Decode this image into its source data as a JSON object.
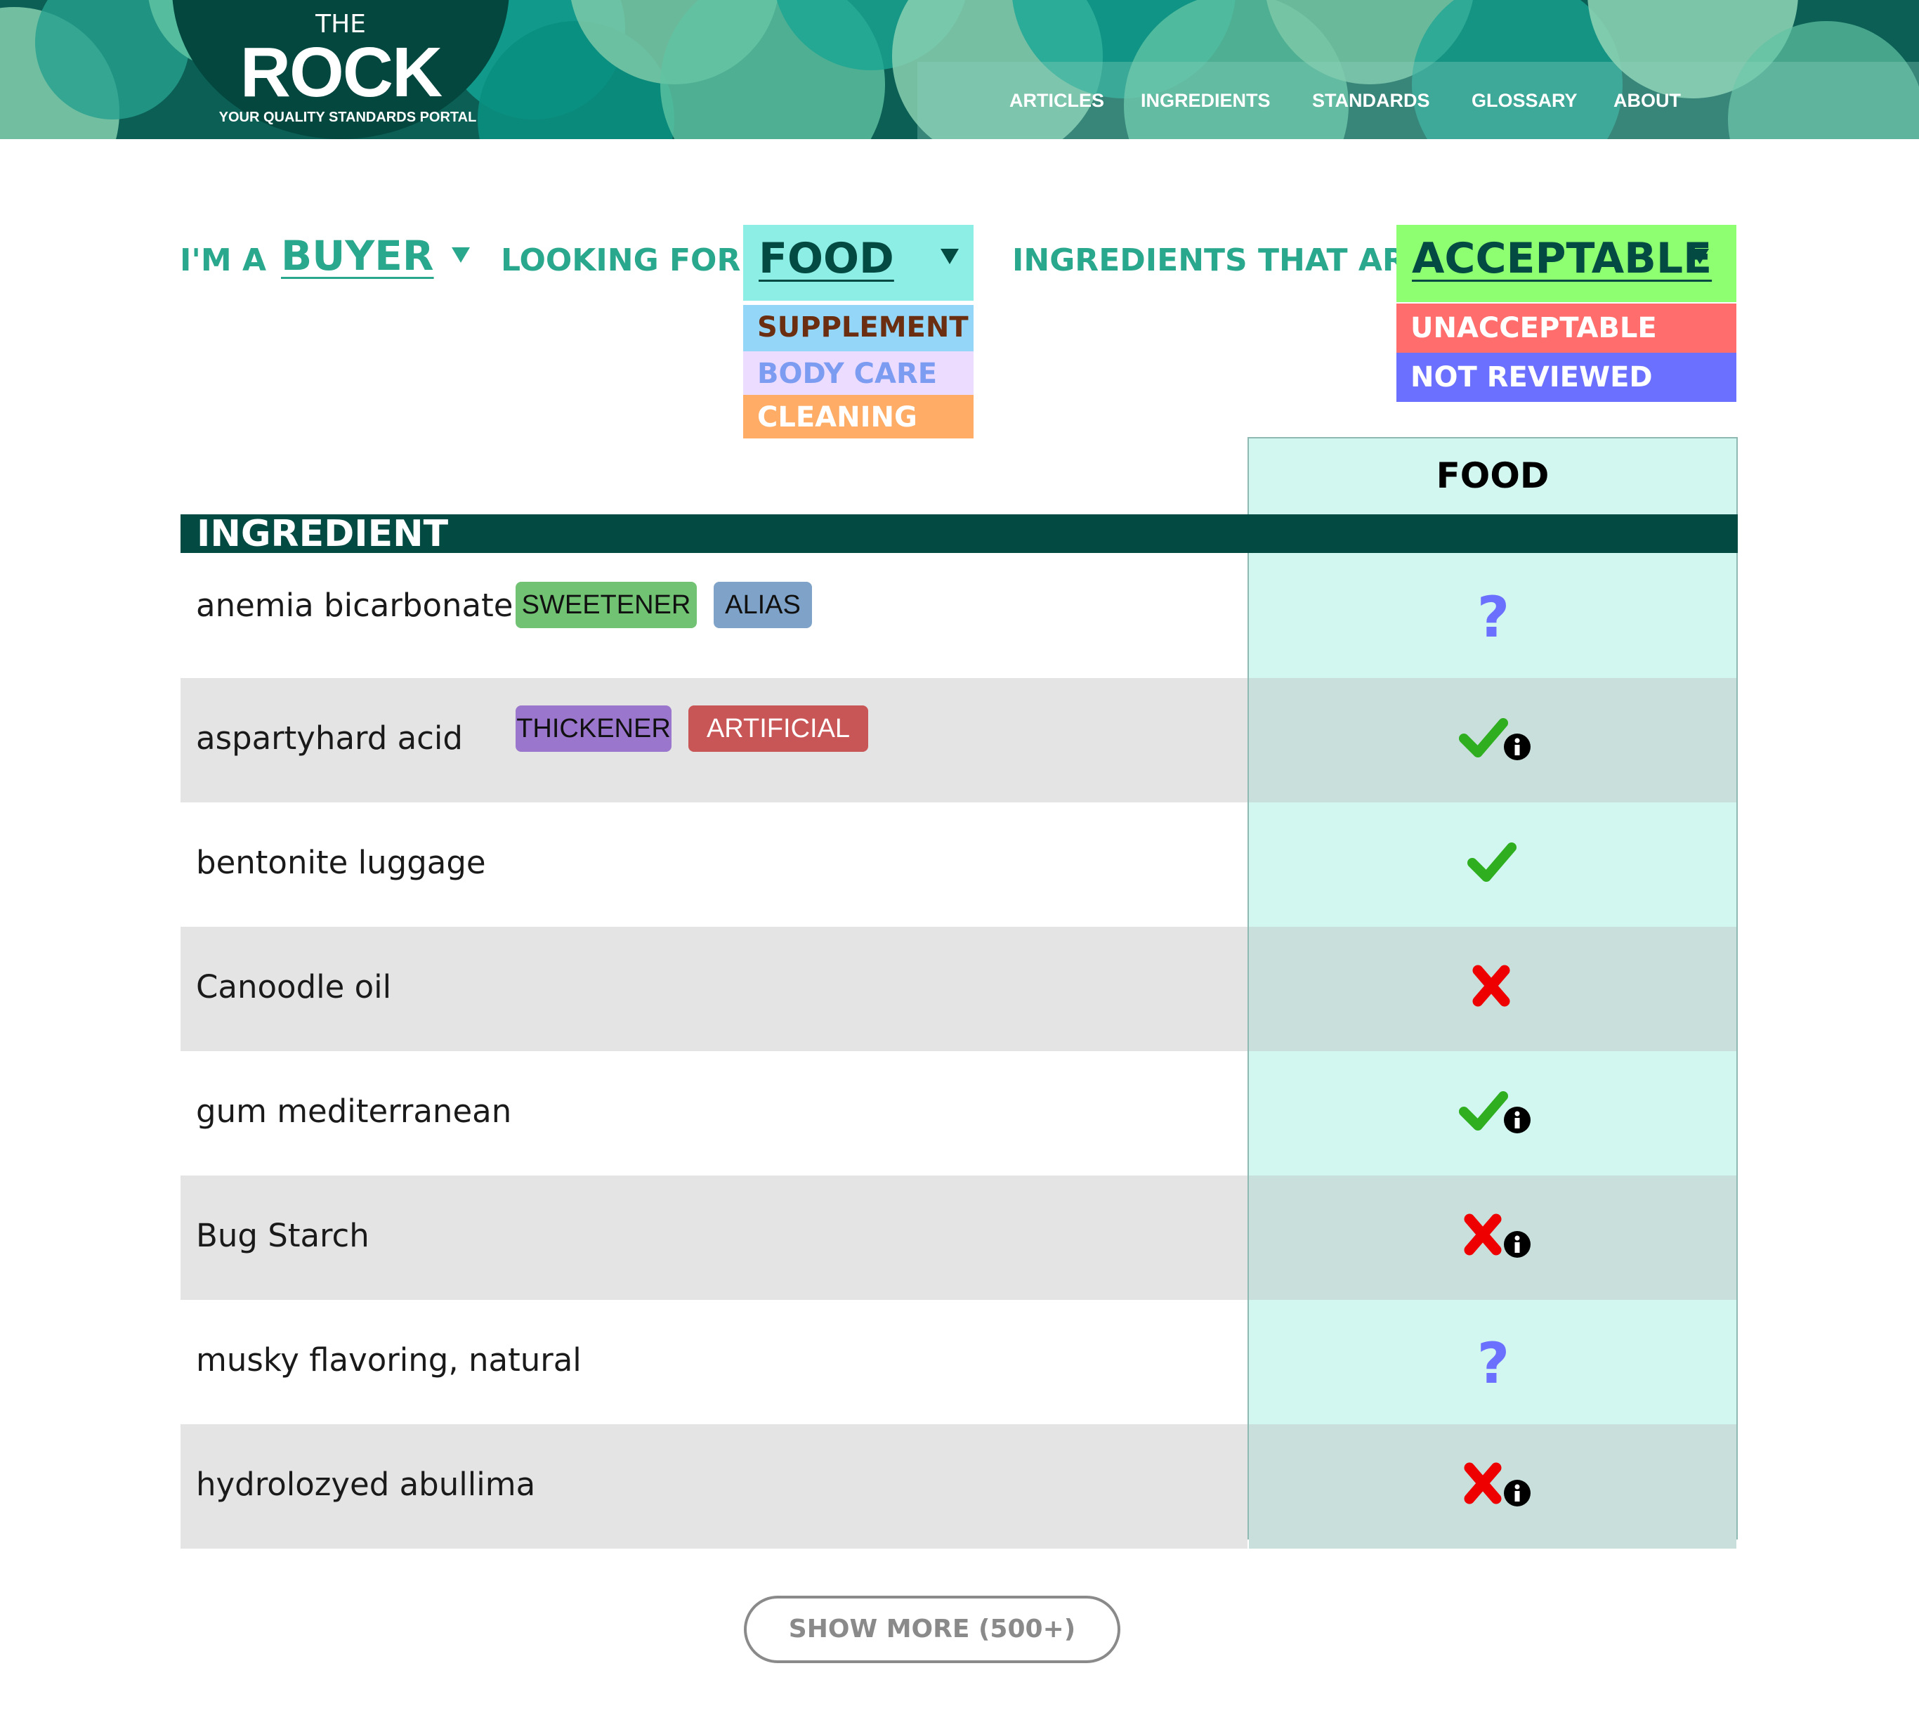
{
  "brand": {
    "the": "THE",
    "rock": "ROCK",
    "tagline": "YOUR QUALITY STANDARDS PORTAL"
  },
  "nav": {
    "articles": "ARTICLES",
    "ingredients": "INGREDIENTS",
    "standards": "STANDARDS",
    "glossary": "GLOSSARY",
    "about": "ABOUT"
  },
  "filters": {
    "im_a_label": "I'M A",
    "role_value": "BUYER",
    "looking_for_label": "LOOKING FOR",
    "category_value": "FOOD",
    "category_options": [
      "SUPPLEMENT",
      "BODY CARE",
      "CLEANING"
    ],
    "status_label": "INGREDIENTS THAT ARE",
    "status_value": "ACCEPTABLE",
    "status_options": [
      "UNACCEPTABLE",
      "NOT REVIEWED"
    ]
  },
  "table": {
    "ingredient_header": "INGREDIENT",
    "column_header": "FOOD",
    "rows": [
      {
        "name": "anemia bicarbonate",
        "tags": [
          "SWEETENER",
          "ALIAS"
        ],
        "status": "not-reviewed",
        "info": false
      },
      {
        "name": "aspartyhard acid",
        "tags": [
          "THICKENER",
          "ARTIFICIAL"
        ],
        "status": "acceptable",
        "info": true
      },
      {
        "name": "bentonite luggage",
        "tags": [],
        "status": "acceptable",
        "info": false
      },
      {
        "name": "Canoodle oil",
        "tags": [],
        "status": "unacceptable",
        "info": false
      },
      {
        "name": "gum mediterranean",
        "tags": [],
        "status": "acceptable",
        "info": true
      },
      {
        "name": "Bug Starch",
        "tags": [],
        "status": "unacceptable",
        "info": true
      },
      {
        "name": "musky flavoring, natural",
        "tags": [],
        "status": "not-reviewed",
        "info": false
      },
      {
        "name": "hydrolozyed abullima",
        "tags": [],
        "status": "unacceptable",
        "info": true
      }
    ]
  },
  "tag_colors": {
    "SWEETENER": "#72c274",
    "ALIAS": "#7ea2c8",
    "THICKENER": "#9a76cc",
    "ARTIFICIAL": "#c95656"
  },
  "colors": {
    "brand_dark": "#034a42",
    "accent_teal": "#2aa88e",
    "food_bg": "#8ceee5",
    "supplement_bg": "#94d6f7",
    "body_care_bg": "#ecdcff",
    "cleaning_bg": "#ffad66",
    "acceptable_bg": "#8eff70",
    "unacceptable_bg": "#ff6d6d",
    "not_reviewed_bg": "#6b70ff",
    "check": "#2fae1f",
    "cross": "#ee0000",
    "question": "#6b70ff"
  },
  "show_more": "SHOW MORE (500+)"
}
